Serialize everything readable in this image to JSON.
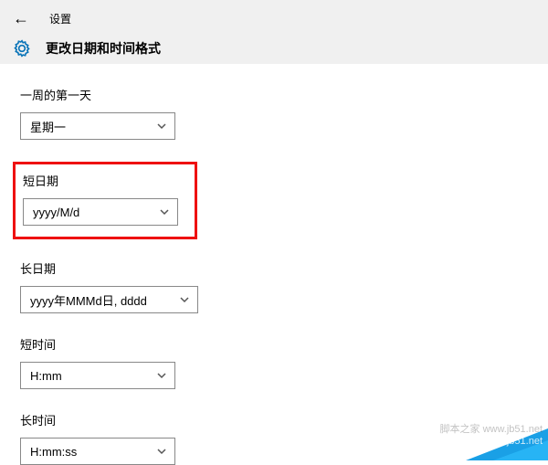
{
  "header": {
    "app_title": "设置",
    "page_title": "更改日期和时间格式"
  },
  "fields": {
    "first_day": {
      "label": "一周的第一天",
      "value": "星期一"
    },
    "short_date": {
      "label": "短日期",
      "value": "yyyy/M/d"
    },
    "long_date": {
      "label": "长日期",
      "value": "yyyy年MMMd日, dddd"
    },
    "short_time": {
      "label": "短时间",
      "value": "H:mm"
    },
    "long_time": {
      "label": "长时间",
      "value": "H:mm:ss"
    }
  },
  "watermark": {
    "line1": "脚本之家 www.jb51.net",
    "line2": "jiaocheng.jb51.net"
  }
}
